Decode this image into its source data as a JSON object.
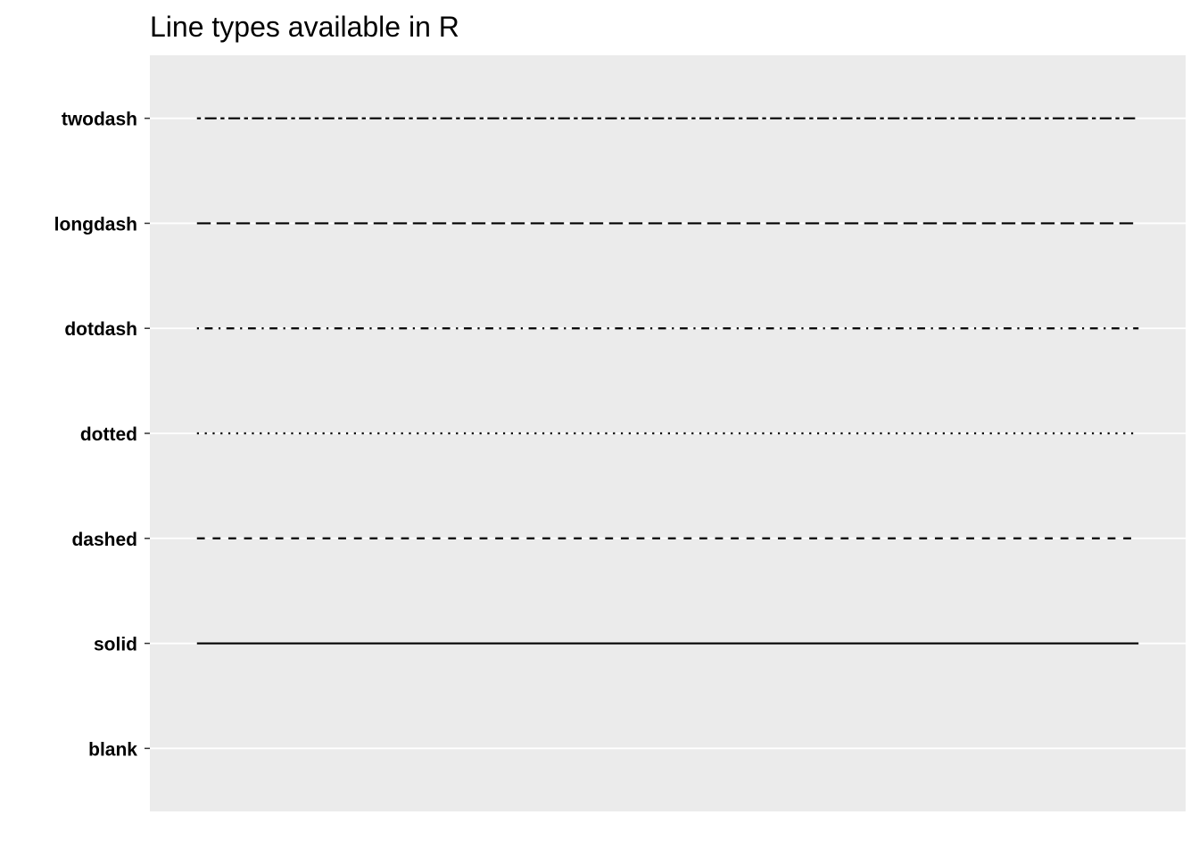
{
  "chart_data": {
    "type": "line",
    "title": "Line types available in R",
    "xlabel": "",
    "ylabel": "",
    "categories": [
      "blank",
      "solid",
      "dashed",
      "dotted",
      "dotdash",
      "longdash",
      "twodash"
    ],
    "series": [
      {
        "category": "twodash",
        "linetype": "twodash",
        "x": [
          0,
          1
        ]
      },
      {
        "category": "longdash",
        "linetype": "longdash",
        "x": [
          0,
          1
        ]
      },
      {
        "category": "dotdash",
        "linetype": "dotdash",
        "x": [
          0,
          1
        ]
      },
      {
        "category": "dotted",
        "linetype": "dotted",
        "x": [
          0,
          1
        ]
      },
      {
        "category": "dashed",
        "linetype": "dashed",
        "x": [
          0,
          1
        ]
      },
      {
        "category": "solid",
        "linetype": "solid",
        "x": [
          0,
          1
        ]
      },
      {
        "category": "blank",
        "linetype": "blank",
        "x": [
          0,
          1
        ]
      }
    ],
    "grid": true,
    "x_axis_visible": false,
    "legend": "none",
    "colors": {
      "panel_background": "#EBEBEB",
      "gridline": "#FFFFFF",
      "line": "#000000",
      "text": "#000000"
    }
  }
}
